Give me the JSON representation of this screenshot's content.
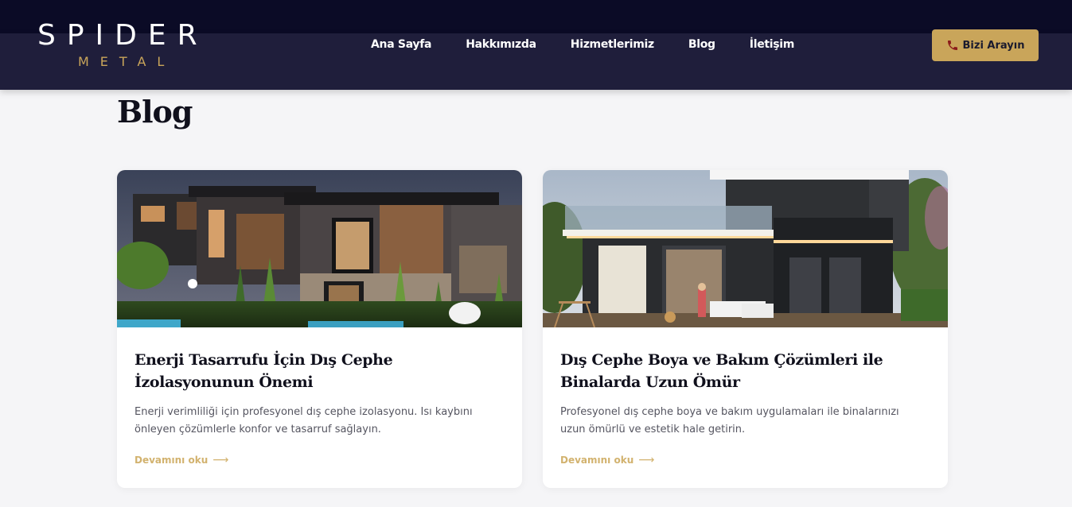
{
  "brand": {
    "name": "SPIDER",
    "tagline": "METAL"
  },
  "nav": {
    "items": [
      {
        "label": "Ana Sayfa"
      },
      {
        "label": "Hakkımızda"
      },
      {
        "label": "Hizmetlerimiz"
      },
      {
        "label": "Blog"
      },
      {
        "label": "İletişim"
      }
    ],
    "cta_label": "Bizi Arayın",
    "cta_icon": "phone-icon"
  },
  "page": {
    "title": "Blog"
  },
  "posts": [
    {
      "title": "Enerji Tasarrufu İçin Dış Cephe İzolasyonunun Önemi",
      "description": "Enerji verimliliği için profesyonel dış cephe izolasyonu. Isı kaybını önleyen çözümlerle konfor ve tasarruf sağlayın.",
      "link_label": "Devamını oku",
      "link_icon": "arrow-right-icon"
    },
    {
      "title": "Dış Cephe Boya ve Bakım Çözümleri ile Binalarda Uzun Ömür",
      "description": "Profesyonel dış cephe boya ve bakım uygulamaları ile binalarınızı uzun ömürlü ve estetik hale getirin.",
      "link_label": "Devamını oku",
      "link_icon": "arrow-right-icon"
    }
  ],
  "colors": {
    "top_strip": "#0b0b26",
    "navbar": "#1f1e3b",
    "accent_gold": "#c9a55a",
    "link_gold": "#d2b26e",
    "page_bg": "#f5f5f7",
    "title_text": "#10101c"
  }
}
